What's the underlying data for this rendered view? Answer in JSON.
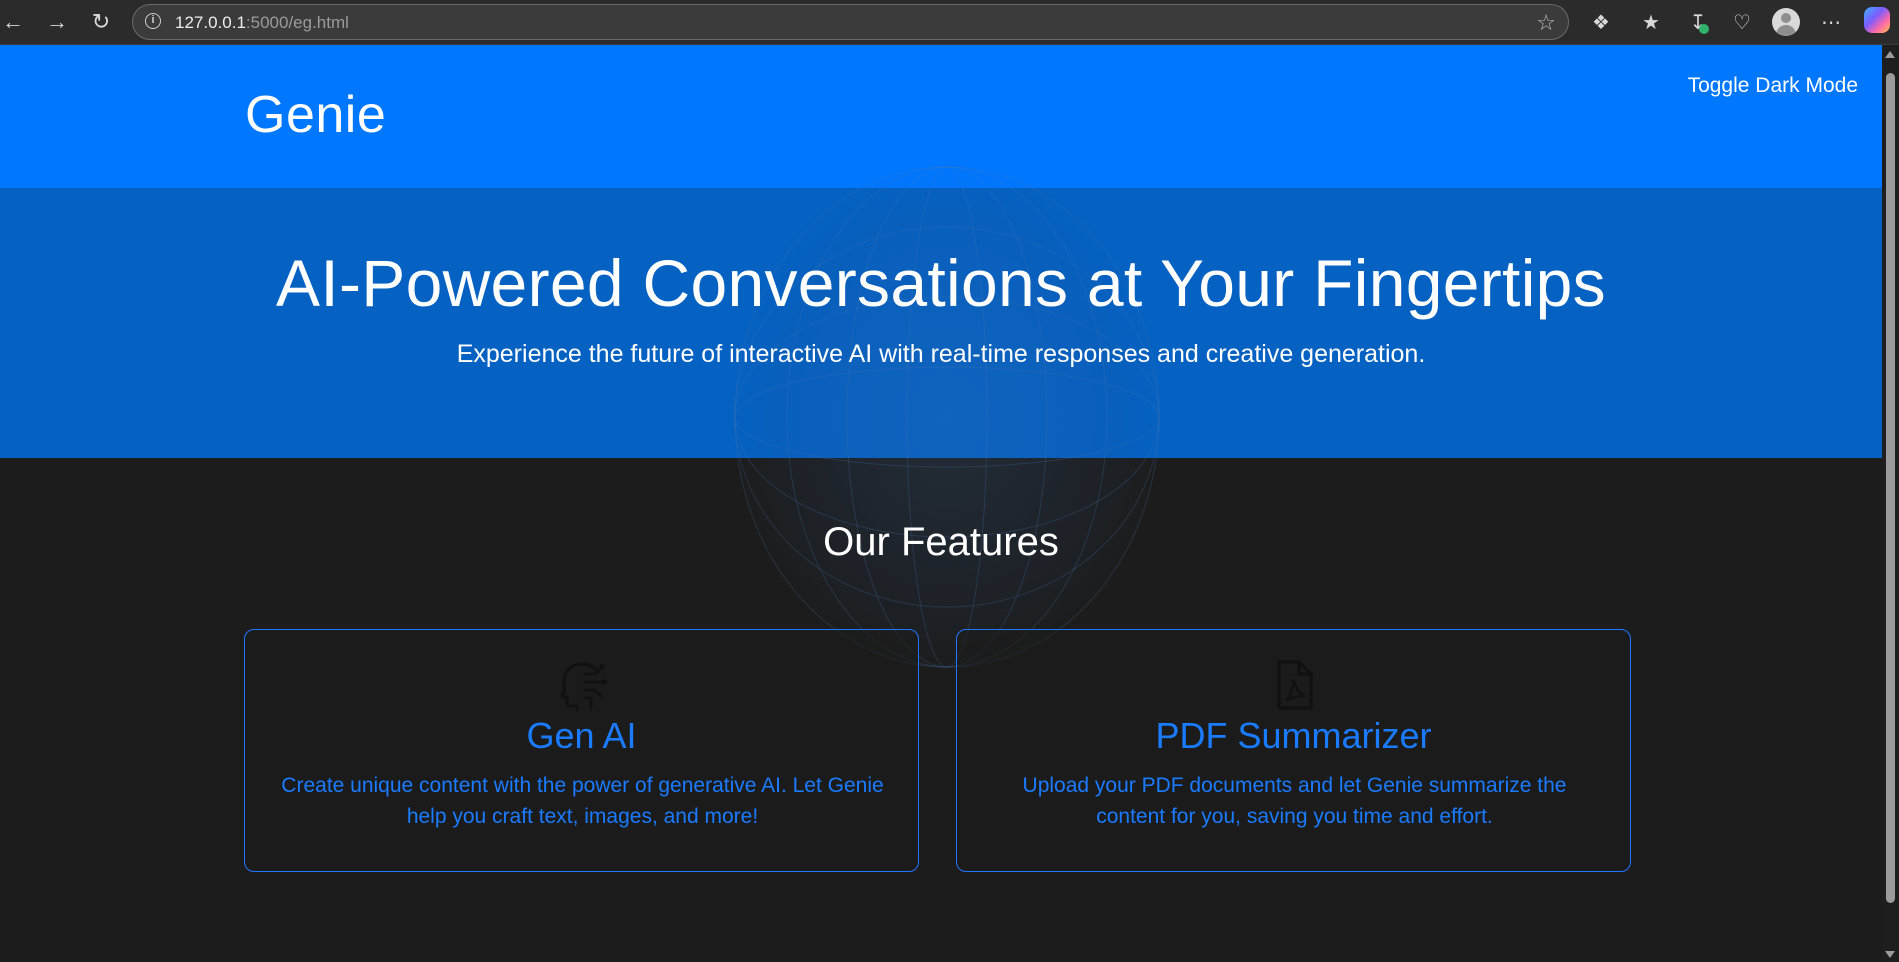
{
  "browser": {
    "url_host": "127.0.0.1",
    "url_path": ":5000/eg.html"
  },
  "header": {
    "brand": "Genie",
    "dark_mode_toggle": "Toggle Dark Mode"
  },
  "hero": {
    "title": "AI-Powered Conversations at Your Fingertips",
    "subtitle": "Experience the future of interactive AI with real-time responses and creative generation."
  },
  "features": {
    "heading": "Our Features",
    "cards": [
      {
        "icon": "head-circuit-icon",
        "title": "Gen AI",
        "description": "Create unique content with the power of generative AI. Let Genie help you craft text, images, and more!"
      },
      {
        "icon": "pdf-file-icon",
        "title": "PDF Summarizer",
        "description": "Upload your PDF documents and let Genie summarize the content for you, saving you time and effort."
      }
    ]
  },
  "colors": {
    "header_bg": "#0077ff",
    "hero_bg": "#0561c2",
    "page_bg": "#1c1c1c",
    "accent": "#1a7bff"
  }
}
